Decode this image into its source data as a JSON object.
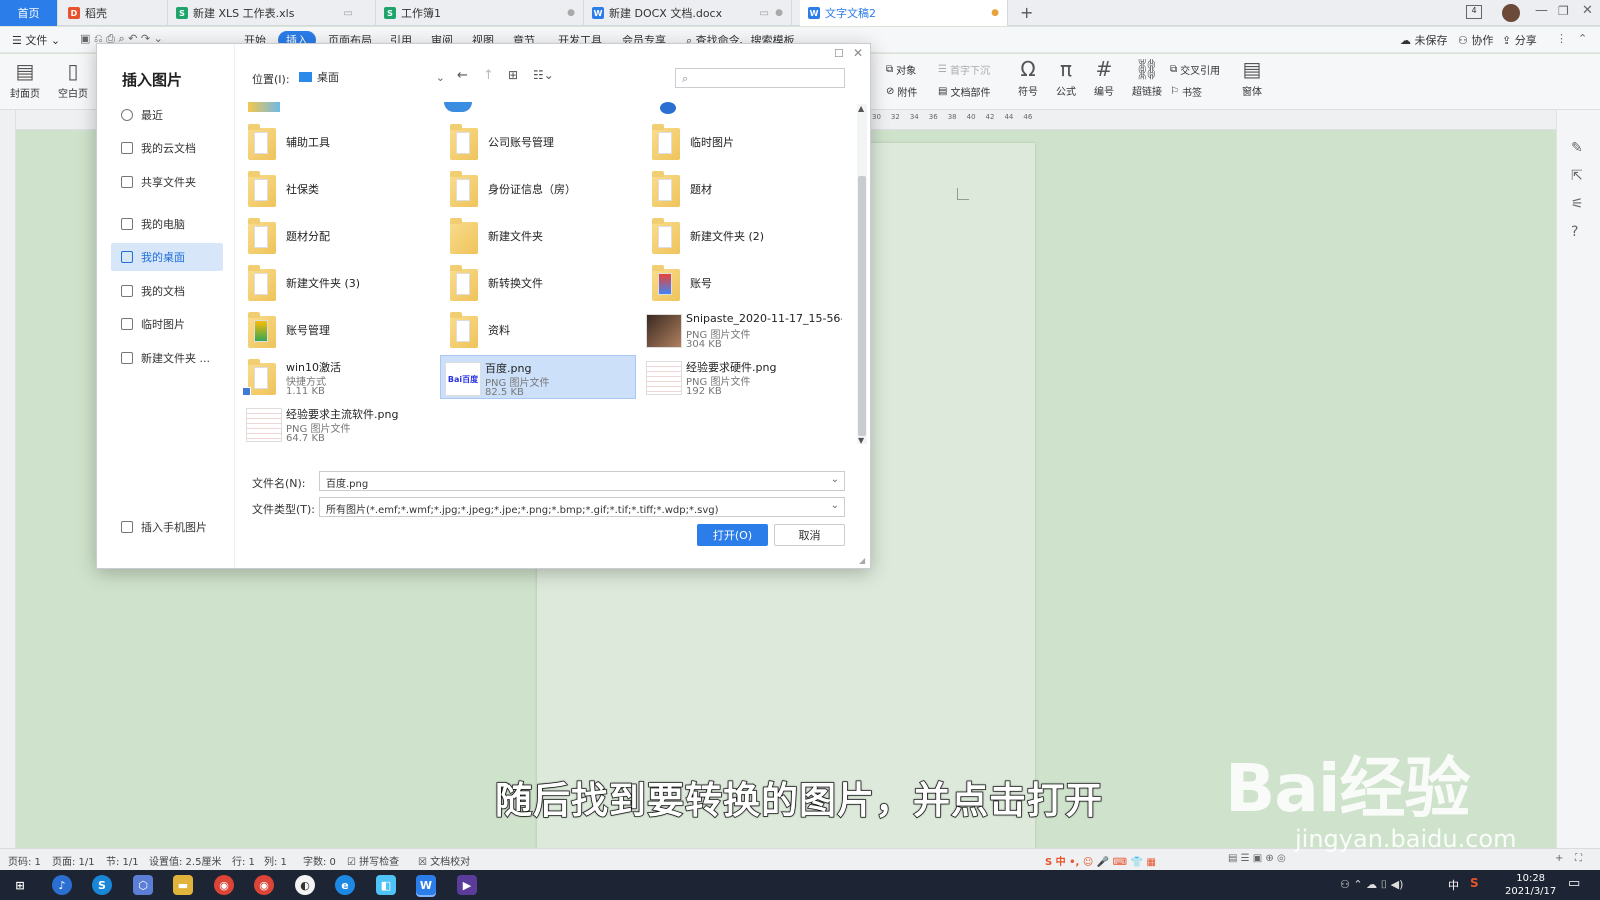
{
  "tabs": [
    {
      "label": "首页",
      "type": "home"
    },
    {
      "label": "稻壳",
      "icon": "docer-icon",
      "color": "#e8532d"
    },
    {
      "label": "新建 XLS 工作表.xls",
      "icon": "spreadsheet-icon",
      "color": "#1fa56b"
    },
    {
      "label": "工作簿1",
      "icon": "spreadsheet-icon",
      "color": "#1fa56b"
    },
    {
      "label": "新建 DOCX 文档.docx",
      "icon": "writer-icon",
      "color": "#2b7de9"
    },
    {
      "label": "文字文稿2",
      "icon": "writer-icon",
      "color": "#2b7de9",
      "active": true
    }
  ],
  "menubar": {
    "file": "文件",
    "items": [
      "开始",
      "插入",
      "页面布局",
      "引用",
      "审阅",
      "视图",
      "章节",
      "开发工具",
      "会员专享"
    ],
    "active": "插入",
    "search": "查找命令、搜索模板",
    "right": [
      "未保存",
      "协作",
      "分享"
    ]
  },
  "ribbon": {
    "left": [
      {
        "label": "封面页",
        "icon": "cover-icon"
      },
      {
        "label": "空白页",
        "icon": "blank-page-icon"
      }
    ],
    "small": [
      "对象",
      "首字下沉",
      "附件",
      "文档部件"
    ],
    "big": [
      {
        "label": "符号",
        "icon": "omega-icon"
      },
      {
        "label": "公式",
        "icon": "pi-icon"
      },
      {
        "label": "编号",
        "icon": "number-icon"
      },
      {
        "label": "超链接",
        "icon": "link-icon"
      },
      {
        "label": "窗体",
        "icon": "form-icon"
      }
    ],
    "refs": [
      "交叉引用",
      "书签"
    ],
    "ruler_ticks": [
      "30",
      "32",
      "34",
      "36",
      "38",
      "40",
      "42",
      "44",
      "46"
    ]
  },
  "dialog": {
    "title": "插入图片",
    "location_label": "位置(I):",
    "location_value": "桌面",
    "sidebar": [
      {
        "label": "最近",
        "icon": "clock-icon"
      },
      {
        "label": "我的云文档",
        "icon": "cloud-icon"
      },
      {
        "label": "共享文件夹",
        "icon": "share-icon"
      },
      {
        "label": "我的电脑",
        "icon": "computer-icon"
      },
      {
        "label": "我的桌面",
        "icon": "desktop-icon",
        "selected": true
      },
      {
        "label": "我的文档",
        "icon": "document-icon"
      },
      {
        "label": "临时图片",
        "icon": "folder-icon"
      },
      {
        "label": "新建文件夹 ...",
        "icon": "folder-icon"
      }
    ],
    "phone_label": "插入手机图片",
    "files": [
      {
        "name": "辅助工具",
        "kind": "folder"
      },
      {
        "name": "公司账号管理",
        "kind": "folder"
      },
      {
        "name": "临时图片",
        "kind": "folder"
      },
      {
        "name": "社保类",
        "kind": "folder"
      },
      {
        "name": "身份证信息（房）",
        "kind": "folder"
      },
      {
        "name": "题材",
        "kind": "folder"
      },
      {
        "name": "题材分配",
        "kind": "folder"
      },
      {
        "name": "新建文件夹",
        "kind": "folder"
      },
      {
        "name": "新建文件夹 (2)",
        "kind": "folder"
      },
      {
        "name": "新建文件夹 (3)",
        "kind": "folder"
      },
      {
        "name": "新转换文件",
        "kind": "folder"
      },
      {
        "name": "账号",
        "kind": "folder"
      },
      {
        "name": "账号管理",
        "kind": "folder"
      },
      {
        "name": "资料",
        "kind": "folder"
      },
      {
        "name": "Snipaste_2020-11-17_15-56-...",
        "kind": "image",
        "type": "PNG 图片文件",
        "size": "304 KB"
      },
      {
        "name": "win10激活",
        "kind": "shortcut",
        "type": "快捷方式",
        "size": "1.11 KB"
      },
      {
        "name": "百度.png",
        "kind": "image",
        "type": "PNG 图片文件",
        "size": "82.5 KB",
        "selected": true,
        "thumb_text": "Bai百度"
      },
      {
        "name": "经验要求硬件.png",
        "kind": "image",
        "type": "PNG 图片文件",
        "size": "192 KB"
      },
      {
        "name": "经验要求主流软件.png",
        "kind": "image",
        "type": "PNG 图片文件",
        "size": "64.7 KB"
      }
    ],
    "filename_label": "文件名(N):",
    "filename_value": "百度.png",
    "filetype_label": "文件类型(T):",
    "filetype_value": "所有图片(*.emf;*.wmf;*.jpg;*.jpeg;*.jpe;*.png;*.bmp;*.gif;*.tif;*.tiff;*.wdp;*.svg)",
    "open_button": "打开(O)",
    "cancel_button": "取消"
  },
  "status": {
    "items": [
      "页码: 1",
      "页面: 1/1",
      "节: 1/1",
      "设置值: 2.5厘米",
      "行: 1",
      "列: 1",
      "字数: 0",
      "拼写检查",
      "文档校对"
    ]
  },
  "taskbar": {
    "time": "10:28",
    "date": "2021/3/17",
    "ime": "中"
  },
  "overlay": {
    "subtitle": "随后找到要转换的图片，并点击打开",
    "watermark": "Bai经验",
    "watermark_url": "jingyan.baidu.com"
  },
  "colors": {
    "accent": "#2b7de9",
    "doc_bg": "#cfe3cc",
    "selection": "#cde0f9"
  }
}
